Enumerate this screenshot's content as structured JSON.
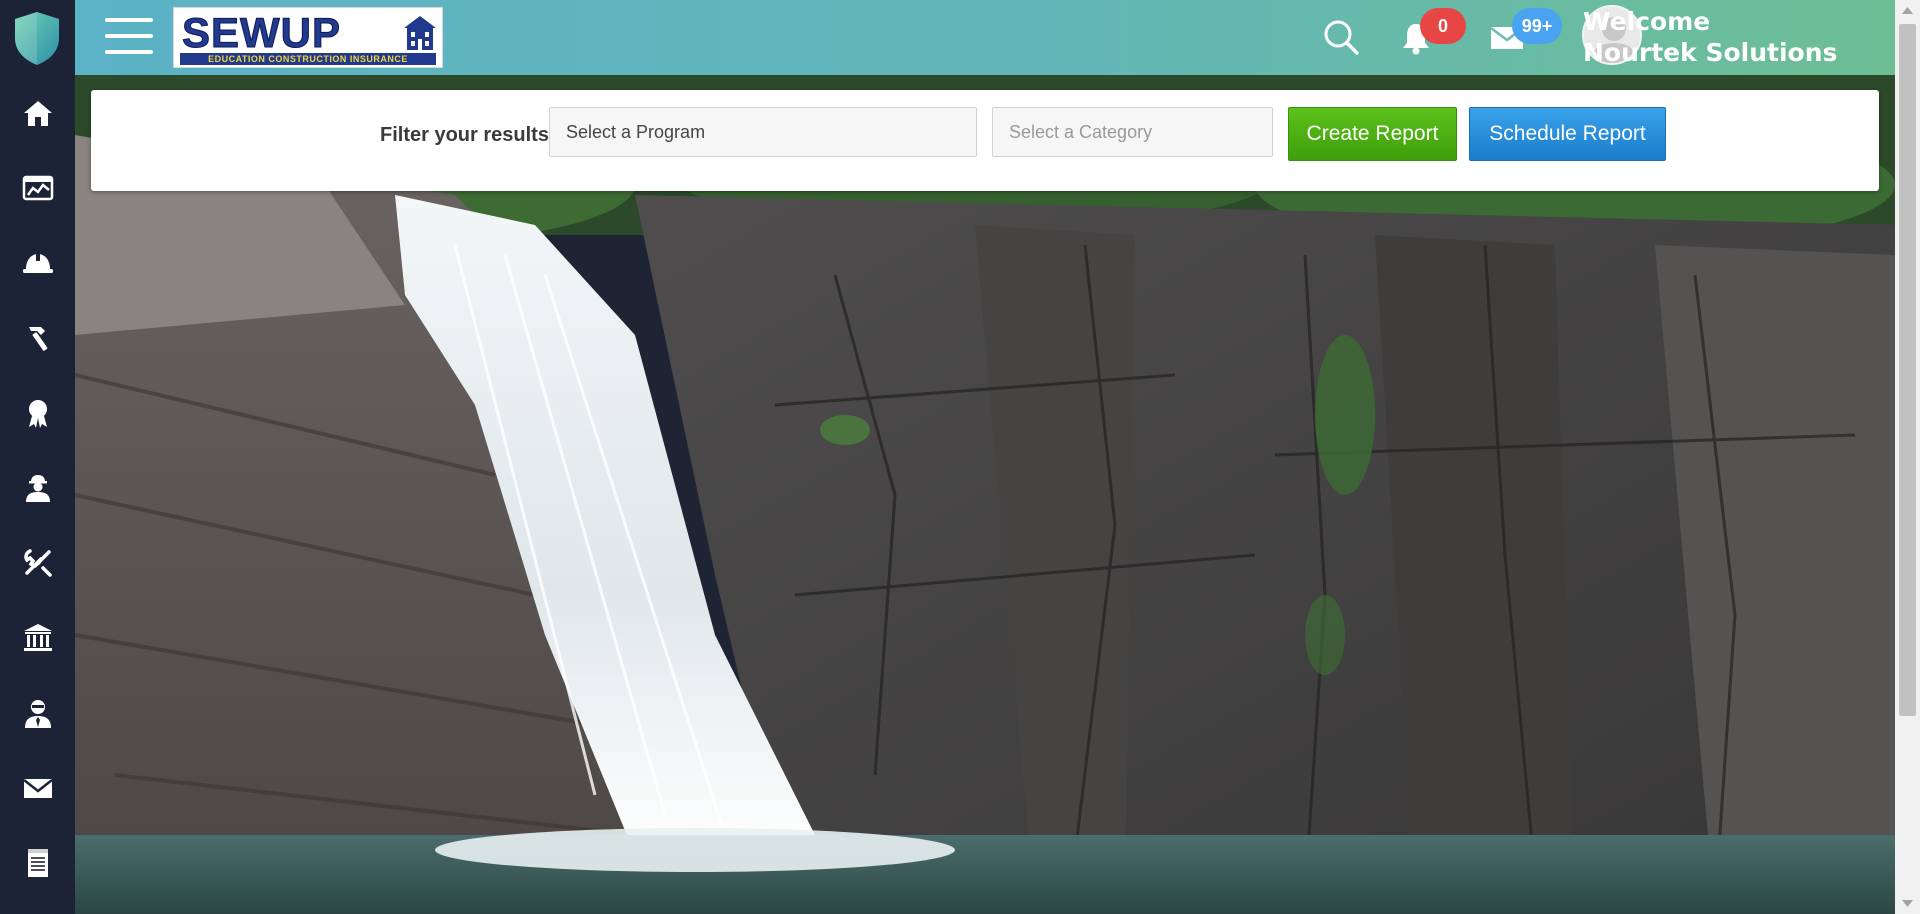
{
  "header": {
    "brand_name": "SEWUP",
    "brand_tagline": "EDUCATION CONSTRUCTION INSURANCE",
    "notifications_count": "0",
    "messages_count": "99+",
    "welcome": "Welcome",
    "user_name": "Nourtek Solutions"
  },
  "sidebar": {
    "items": [
      {
        "icon": "home-icon"
      },
      {
        "icon": "dashboard-chart-icon"
      },
      {
        "icon": "hard-hat-icon"
      },
      {
        "icon": "hammer-icon"
      },
      {
        "icon": "award-ribbon-icon"
      },
      {
        "icon": "worker-icon"
      },
      {
        "icon": "tools-icon"
      },
      {
        "icon": "bank-icon"
      },
      {
        "icon": "user-tie-icon"
      },
      {
        "icon": "envelope-icon"
      },
      {
        "icon": "document-icon"
      }
    ]
  },
  "filter": {
    "label": "Filter your results",
    "program_placeholder": "Select a Program",
    "category_placeholder": "Select a Category",
    "create_report": "Create Report",
    "schedule_report": "Schedule Report"
  },
  "colors": {
    "sidebar_bg": "#1d2337",
    "header_start": "#5cb2c6",
    "header_end": "#6dbe94",
    "create_button": "#4caf13",
    "schedule_button": "#2a8fdc",
    "notification_badge": "#e84545",
    "message_badge": "#4aa3f0"
  }
}
